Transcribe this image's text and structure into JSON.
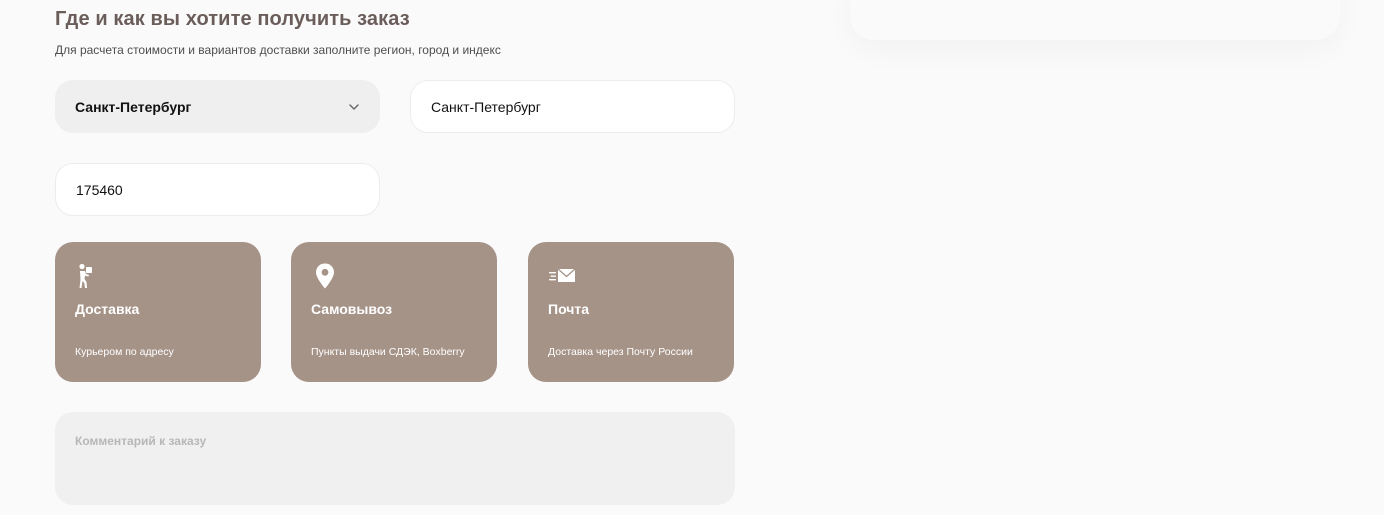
{
  "section": {
    "title": "Где и как вы хотите получить заказ",
    "subtitle": "Для расчета стоимости и вариантов доставки заполните регион, город и индекс"
  },
  "form": {
    "region": {
      "value": "Санкт-Петербург",
      "icon": "chevron-down-icon"
    },
    "city": {
      "value": "Санкт-Петербург"
    },
    "zip": {
      "value": "175460"
    },
    "comment": {
      "placeholder": "Комментарий к заказу"
    }
  },
  "delivery_options": [
    {
      "title": "Доставка",
      "description": "Курьером по адресу",
      "icon": "courier-icon"
    },
    {
      "title": "Самовывоз",
      "description": "Пункты выдачи СДЭК, Boxberry",
      "icon": "map-pin-icon"
    },
    {
      "title": "Почта",
      "description": "Доставка через Почту России",
      "icon": "mail-icon"
    }
  ],
  "colors": {
    "title": "#6a5d5a",
    "card_bg": "#a69388",
    "select_bg": "#efefef",
    "input_bg": "#ffffff",
    "page_bg": "#fafafa"
  }
}
